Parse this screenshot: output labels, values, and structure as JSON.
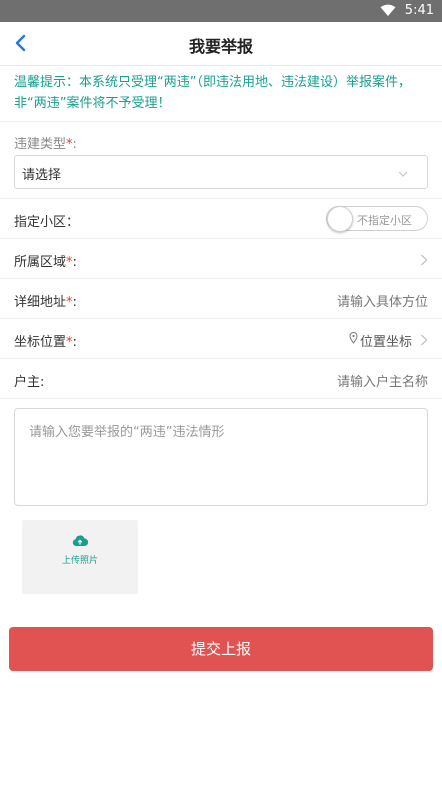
{
  "status_bar": {
    "time": "5:41"
  },
  "nav": {
    "title": "我要举报"
  },
  "notice": {
    "text": "温馨提示：本系统只受理“两违”（即违法用地、违法建设）举报案件，非“两违”案件将不予受理！"
  },
  "form": {
    "type": {
      "label": "违建类型",
      "required_mark": "*",
      "colon": ":",
      "select_value": "请选择"
    },
    "community": {
      "label": "指定小区：",
      "toggle_text": "不指定小区"
    },
    "region": {
      "label": "所属区域",
      "required_mark": "*",
      "colon": ":"
    },
    "address": {
      "label": "详细地址",
      "required_mark": "*",
      "colon": ":",
      "placeholder": "请输入具体方位"
    },
    "coordinate": {
      "label": "坐标位置",
      "required_mark": "*",
      "colon": ":",
      "value": "位置坐标"
    },
    "owner": {
      "label": "户主:",
      "placeholder": "请输入户主名称"
    },
    "description": {
      "placeholder": "请输入您要举报的“两违”违法情形"
    },
    "upload": {
      "label": "上传照片"
    }
  },
  "submit": {
    "label": "提交上报"
  },
  "colors": {
    "accent": "#1a9f8e",
    "submit": "#e15353",
    "required": "#e53935"
  },
  "icons": {
    "back": "chevron-left-icon",
    "wifi": "wifi-icon",
    "upload": "cloud-upload-icon",
    "pin": "location-pin-icon"
  }
}
